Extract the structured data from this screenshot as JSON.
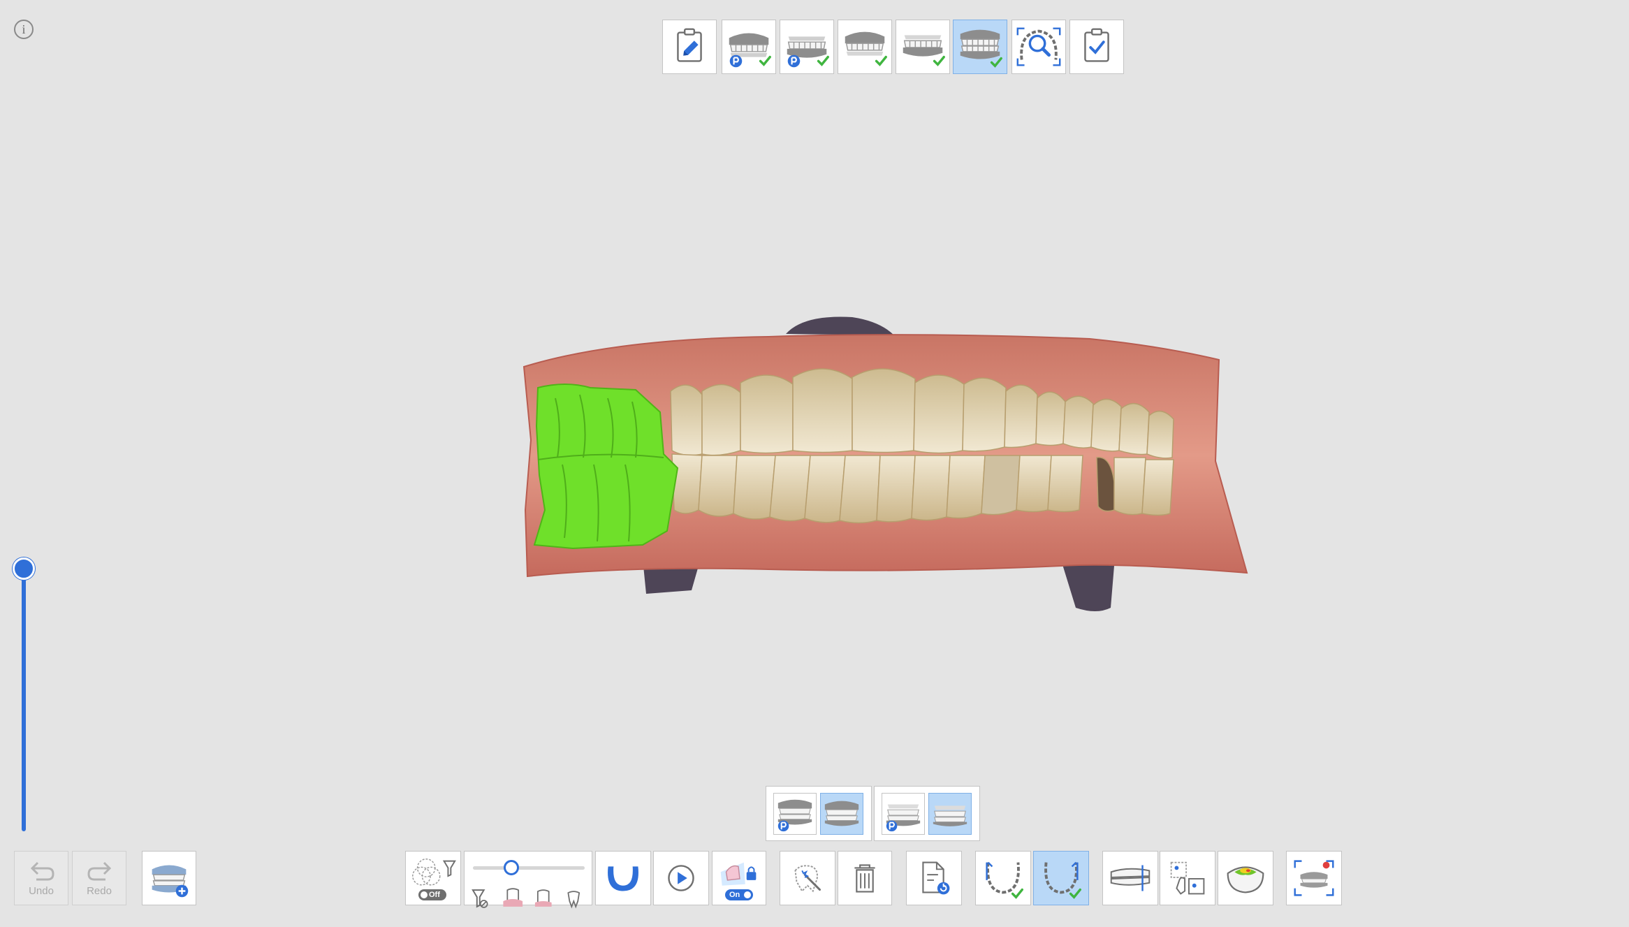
{
  "info": {
    "glyph": "i"
  },
  "workflow_steps": [
    {
      "name": "edit-info-step",
      "icon": "pencil-clipboard-icon",
      "done": false
    },
    {
      "name": "upper-jaw-pre-op-step",
      "icon": "upper-jaw-pre-op-icon",
      "done": true
    },
    {
      "name": "lower-jaw-pre-op-step",
      "icon": "lower-jaw-pre-op-icon",
      "done": true
    },
    {
      "name": "upper-jaw-step",
      "icon": "upper-jaw-icon",
      "done": true
    },
    {
      "name": "lower-jaw-step",
      "icon": "lower-jaw-icon",
      "done": true
    },
    {
      "name": "occlusion-step",
      "icon": "occlusion-icon",
      "done": true,
      "active": true
    },
    {
      "name": "scan-review-step",
      "icon": "arch-magnifier-icon",
      "done": false
    },
    {
      "name": "complete-step",
      "icon": "check-clipboard-icon",
      "done": false
    }
  ],
  "bottom_toolbar": {
    "undo_label": "Undo",
    "redo_label": "Redo",
    "filter_toggle_label": "Off",
    "lock_toggle_label": "On"
  },
  "colors": {
    "background": "#e4e4e4",
    "accent_blue": "#2f6fd8",
    "active_button": "#b9d8f7",
    "check_green": "#3fb53f",
    "selection_green": "#6fe02a"
  }
}
